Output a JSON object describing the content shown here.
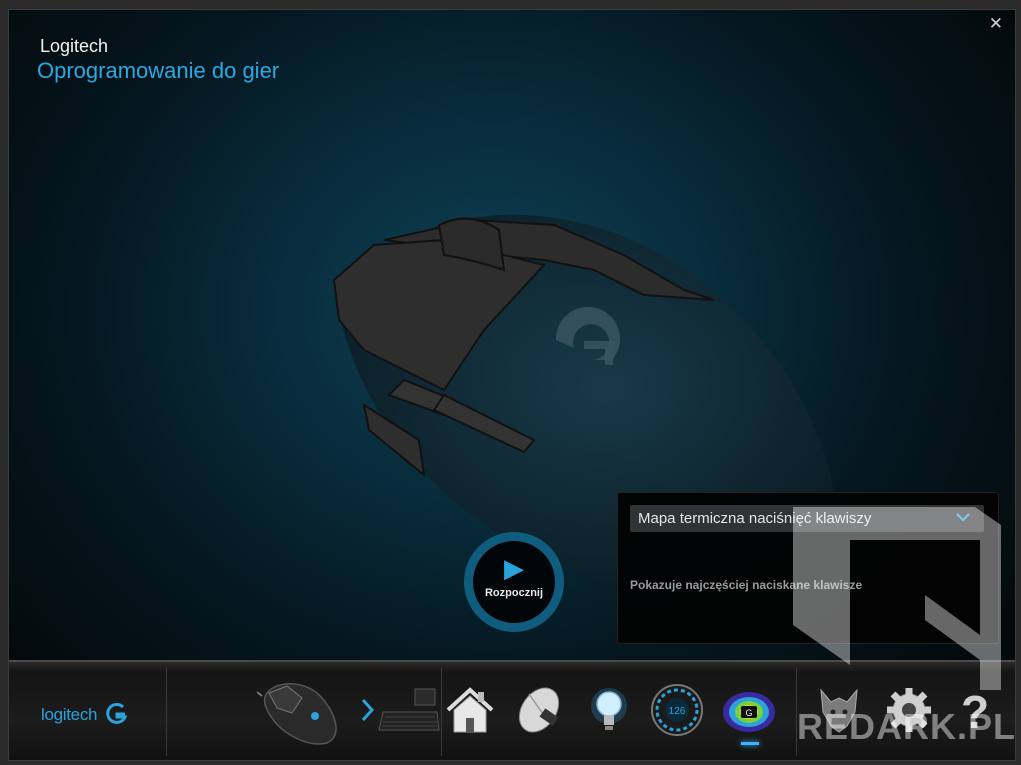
{
  "header": {
    "brand": "Logitech",
    "subtitle": "Oprogramowanie do gier",
    "close_glyph": "✕"
  },
  "start_button": {
    "label": "Rozpocznij",
    "icon": "play-icon"
  },
  "feature_panel": {
    "selected_option": "Mapa termiczna naciśnięć klawiszy",
    "description": "Pokazuje najczęściej naciskane klawisze"
  },
  "bottom_bar": {
    "logo_text": "logitech",
    "devices": [
      "mouse-device-icon",
      "keyboard-device-icon"
    ],
    "toolbar": [
      {
        "name": "home-icon"
      },
      {
        "name": "mouse-settings-icon"
      },
      {
        "name": "lighting-bulb-icon"
      },
      {
        "name": "speedometer-icon"
      },
      {
        "name": "heatmap-icon",
        "active": true
      },
      {
        "name": "game-profile-icon"
      },
      {
        "name": "settings-gear-icon"
      },
      {
        "name": "help-icon"
      }
    ]
  },
  "watermark": {
    "text": "REDARK.PL"
  },
  "colors": {
    "accent": "#2aa3dd",
    "background": "#062230",
    "panel": "#030303"
  }
}
